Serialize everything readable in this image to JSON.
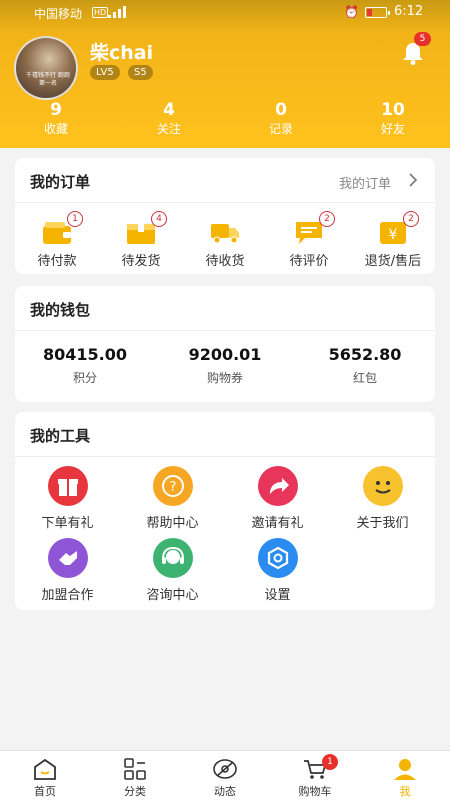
{
  "status_bar": {
    "carrier": "中国移动",
    "network_badge": "HD",
    "time": "6:12"
  },
  "profile": {
    "avatar_caption": "千禧钱不行 跑跑第一名",
    "username": "柴chai",
    "level": "LV5",
    "season": "S5",
    "notification_count": "5"
  },
  "stats": [
    {
      "value": "9",
      "label": "收藏"
    },
    {
      "value": "4",
      "label": "关注"
    },
    {
      "value": "0",
      "label": "记录"
    },
    {
      "value": "10",
      "label": "好友"
    }
  ],
  "orders": {
    "title": "我的订单",
    "more_label": "我的订单",
    "items": [
      {
        "label": "待付款",
        "badge": "1",
        "icon": "wallet-icon"
      },
      {
        "label": "待发货",
        "badge": "4",
        "icon": "package-icon"
      },
      {
        "label": "待收货",
        "badge": "",
        "icon": "truck-icon"
      },
      {
        "label": "待评价",
        "badge": "2",
        "icon": "comment-icon"
      },
      {
        "label": "退货/售后",
        "badge": "2",
        "icon": "refund-icon"
      }
    ]
  },
  "wallet": {
    "title": "我的钱包",
    "items": [
      {
        "value": "80415.00",
        "label": "积分"
      },
      {
        "value": "9200.01",
        "label": "购物券"
      },
      {
        "value": "5652.80",
        "label": "红包"
      }
    ]
  },
  "tools": {
    "title": "我的工具",
    "items": [
      {
        "label": "下单有礼",
        "icon": "gift-icon",
        "color": "#e8363e"
      },
      {
        "label": "帮助中心",
        "icon": "help-icon",
        "color": "#f5a623"
      },
      {
        "label": "邀请有礼",
        "icon": "share-arrow-icon",
        "color": "#e8365a"
      },
      {
        "label": "关于我们",
        "icon": "smiley-icon",
        "color": "#f8c22e"
      },
      {
        "label": "加盟合作",
        "icon": "handshake-icon",
        "color": "#8e55d6"
      },
      {
        "label": "咨询中心",
        "icon": "headset-icon",
        "color": "#3cb371"
      },
      {
        "label": "设置",
        "icon": "settings-icon",
        "color": "#2a8cf0"
      }
    ]
  },
  "tabbar": {
    "active_color": "#f4b400",
    "items": [
      {
        "label": "首页",
        "icon": "home-icon"
      },
      {
        "label": "分类",
        "icon": "category-icon"
      },
      {
        "label": "动态",
        "icon": "feed-icon"
      },
      {
        "label": "购物车",
        "icon": "cart-icon",
        "badge": "1"
      },
      {
        "label": "我",
        "icon": "profile-icon",
        "active": true
      }
    ]
  }
}
